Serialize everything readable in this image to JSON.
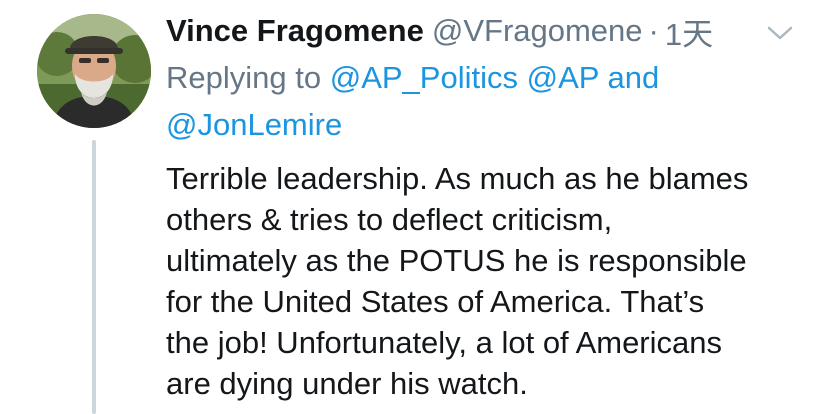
{
  "tweet": {
    "author_name": "Vince Fragomene",
    "author_handle": "@VFragomene",
    "separator": "·",
    "timestamp": "1天",
    "reply": {
      "prefix": "Replying to",
      "mention_1": "@AP_Politics",
      "mention_2": "@AP",
      "conjunction": "and",
      "mention_3": "@JonLemire"
    },
    "text_lines": [
      "Terrible leadership.  As much as he blames",
      "others & tries to deflect criticism,",
      "ultimately as the POTUS he is responsible",
      "for the United States of America.  That’s",
      "the job!  Unfortunately, a lot of Americans",
      "are dying under his watch."
    ]
  },
  "icons": {
    "menu_caret": "chevron-down-icon",
    "avatar": "avatar-photo"
  },
  "colors": {
    "text": "#14171a",
    "secondary": "#657786",
    "link": "#1b95e0",
    "thread_line": "#ccd6dd"
  }
}
